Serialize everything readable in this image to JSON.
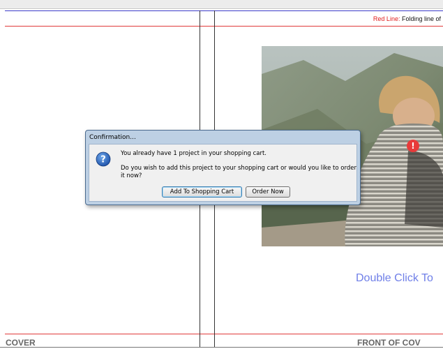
{
  "legend": {
    "red_label": "Red Line:",
    "red_text": " Folding line of"
  },
  "canvas": {
    "placeholder_text": "Double Click To",
    "cover_label": "COVER",
    "front_label": "FRONT OF COV"
  },
  "dialog": {
    "title": "Confirmation...",
    "message_line1": "You already have 1 project in your shopping cart.",
    "message_line2": "Do you wish to add this project to your shopping cart or would you like to order it now?",
    "add_button_label": "Add To Shopping Cart",
    "order_button_label": "Order Now"
  },
  "icons": {
    "dialog_icon": "question-icon",
    "photo_badge": "warning-icon"
  },
  "colors": {
    "fold_line": "#e03a3a",
    "guide_line": "#3a3ac8",
    "placeholder": "#6f7fe8",
    "dialog_frame": "#bdd0e4"
  }
}
